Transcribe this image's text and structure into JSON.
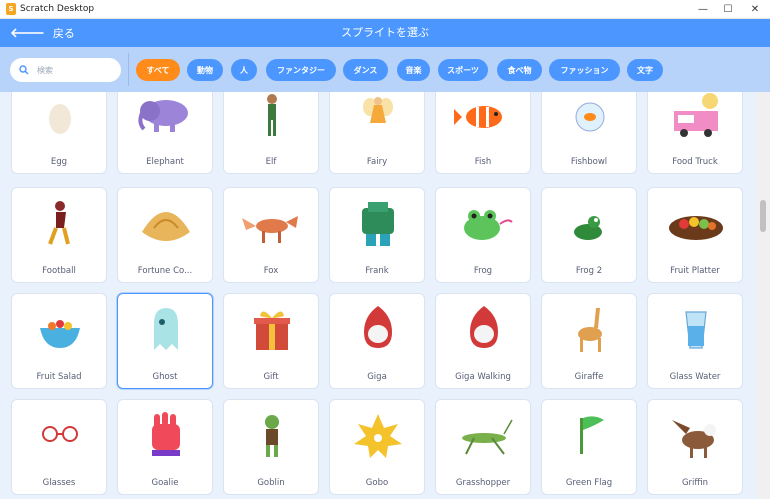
{
  "window": {
    "title": "Scratch Desktop",
    "minimize_glyph": "—",
    "maximize_glyph": "☐",
    "close_glyph": "✕"
  },
  "header": {
    "back_label": "戻る",
    "title": "スプライトを選ぶ"
  },
  "search": {
    "placeholder": "検索"
  },
  "filters": [
    {
      "label": "すべて",
      "active": true
    },
    {
      "label": "動物"
    },
    {
      "label": "人"
    },
    {
      "label": "ファンタジー"
    },
    {
      "label": "ダンス"
    },
    {
      "label": "音楽"
    },
    {
      "label": "スポーツ"
    },
    {
      "label": "食べ物"
    },
    {
      "label": "ファッション"
    },
    {
      "label": "文字"
    }
  ],
  "sprites": [
    {
      "name": "Egg",
      "icon": "egg-icon"
    },
    {
      "name": "Elephant",
      "icon": "elephant-icon"
    },
    {
      "name": "Elf",
      "icon": "elf-icon"
    },
    {
      "name": "Fairy",
      "icon": "fairy-icon"
    },
    {
      "name": "Fish",
      "icon": "fish-icon"
    },
    {
      "name": "Fishbowl",
      "icon": "fishbowl-icon"
    },
    {
      "name": "Food Truck",
      "icon": "food-truck-icon"
    },
    {
      "name": "Football",
      "icon": "football-player-icon"
    },
    {
      "name": "Fortune Co...",
      "icon": "fortune-cookie-icon"
    },
    {
      "name": "Fox",
      "icon": "fox-icon"
    },
    {
      "name": "Frank",
      "icon": "frank-icon"
    },
    {
      "name": "Frog",
      "icon": "frog-icon"
    },
    {
      "name": "Frog 2",
      "icon": "frog-2-icon"
    },
    {
      "name": "Fruit Platter",
      "icon": "fruit-platter-icon"
    },
    {
      "name": "Fruit Salad",
      "icon": "fruit-salad-icon"
    },
    {
      "name": "Ghost",
      "icon": "ghost-icon",
      "selected": true
    },
    {
      "name": "Gift",
      "icon": "gift-icon"
    },
    {
      "name": "Giga",
      "icon": "giga-icon"
    },
    {
      "name": "Giga Walking",
      "icon": "giga-walking-icon"
    },
    {
      "name": "Giraffe",
      "icon": "giraffe-icon"
    },
    {
      "name": "Glass Water",
      "icon": "glass-water-icon"
    },
    {
      "name": "Glasses",
      "icon": "glasses-icon"
    },
    {
      "name": "Goalie",
      "icon": "goalie-glove-icon"
    },
    {
      "name": "Goblin",
      "icon": "goblin-icon"
    },
    {
      "name": "Gobo",
      "icon": "gobo-icon"
    },
    {
      "name": "Grasshopper",
      "icon": "grasshopper-icon"
    },
    {
      "name": "Green Flag",
      "icon": "green-flag-icon"
    },
    {
      "name": "Griffin",
      "icon": "griffin-icon"
    }
  ],
  "colors": {
    "header": "#4c97ff",
    "filterbar": "#b8d3f9",
    "active_tag": "#ff8c1a",
    "library_bg": "#e9f1fc"
  }
}
